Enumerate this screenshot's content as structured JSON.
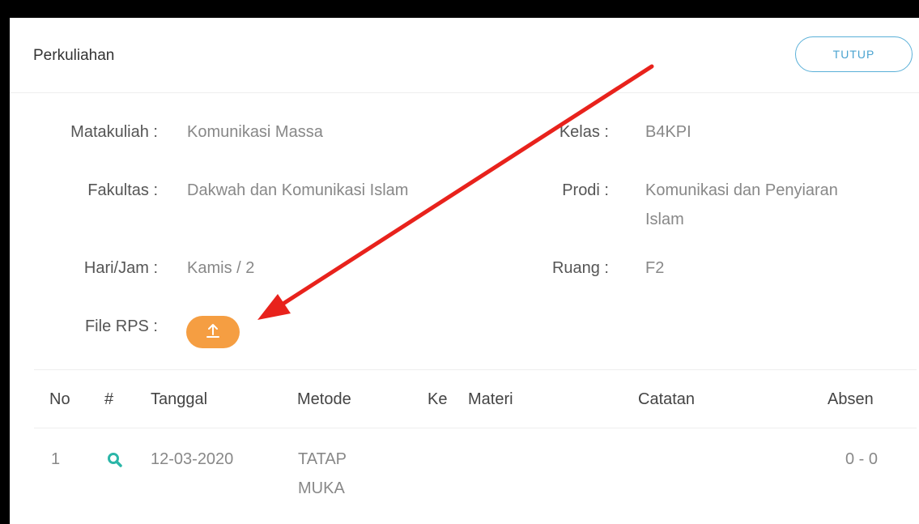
{
  "header": {
    "title": "Perkuliahan",
    "close_label": "TUTUP"
  },
  "info": {
    "matakuliah_label": "Matakuliah :",
    "matakuliah_value": "Komunikasi Massa",
    "kelas_label": "Kelas :",
    "kelas_value": "B4KPI",
    "fakultas_label": "Fakultas :",
    "fakultas_value": "Dakwah dan Komunikasi Islam",
    "prodi_label": "Prodi :",
    "prodi_value_line1": "Komunikasi dan Penyiaran",
    "prodi_value_line2": "Islam",
    "harijam_label": "Hari/Jam :",
    "harijam_value": "Kamis / 2",
    "ruang_label": "Ruang :",
    "ruang_value": "F2",
    "filerps_label": "File RPS :"
  },
  "table": {
    "headers": [
      "No",
      "#",
      "Tanggal",
      "Metode",
      "Ke",
      "Materi",
      "Catatan",
      "Absen"
    ],
    "rows": [
      {
        "no": "1",
        "tanggal": "12-03-2020",
        "metode_line1": "TATAP",
        "metode_line2": "MUKA",
        "ke": "",
        "materi": "",
        "catatan": "",
        "absen": "0 - 0"
      }
    ]
  },
  "icons": {
    "upload": "upload-icon",
    "search": "search-icon"
  },
  "colors": {
    "accent_orange": "#f59e42",
    "teal": "#2bb6a8",
    "button_border": "#5ab0d8",
    "annotation_arrow": "#e8221c"
  }
}
